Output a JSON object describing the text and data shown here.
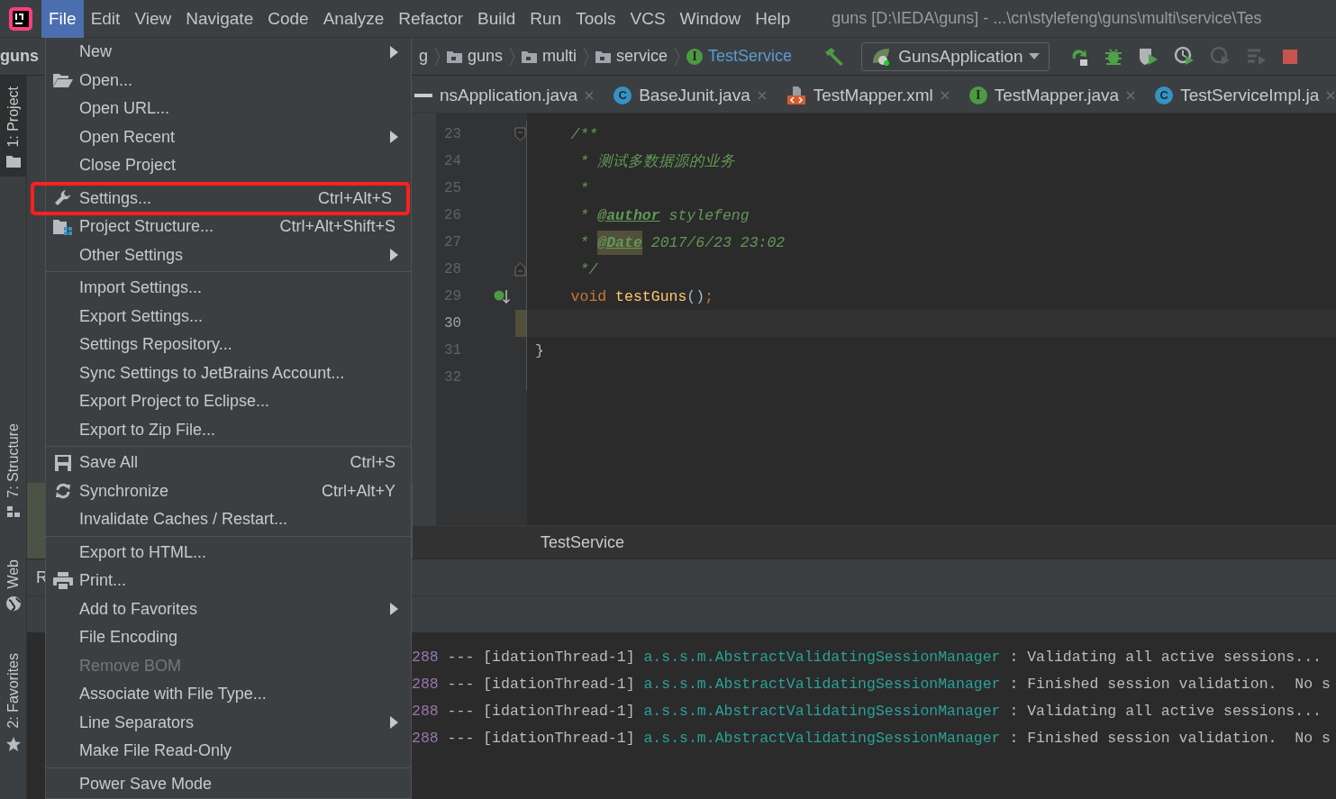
{
  "window": {
    "title": "guns [D:\\IEDA\\guns] - ...\\cn\\stylefeng\\guns\\multi\\service\\Tes"
  },
  "menu_bar": [
    {
      "label": "File",
      "selected": true
    },
    {
      "label": "Edit",
      "selected": false
    },
    {
      "label": "View",
      "selected": false
    },
    {
      "label": "Navigate",
      "selected": false
    },
    {
      "label": "Code",
      "selected": false
    },
    {
      "label": "Analyze",
      "selected": false
    },
    {
      "label": "Refactor",
      "selected": false
    },
    {
      "label": "Build",
      "selected": false
    },
    {
      "label": "Run",
      "selected": false
    },
    {
      "label": "Tools",
      "selected": false
    },
    {
      "label": "VCS",
      "selected": false
    },
    {
      "label": "Window",
      "selected": false
    },
    {
      "label": "Help",
      "selected": false
    }
  ],
  "navigation_bar": {
    "project": "guns",
    "crumbs": [
      {
        "label": "g",
        "kind": "text"
      },
      {
        "label": "guns",
        "kind": "folder"
      },
      {
        "label": "multi",
        "kind": "folder"
      },
      {
        "label": "service",
        "kind": "folder"
      },
      {
        "label": "TestService",
        "kind": "interface",
        "badge": "I"
      }
    ]
  },
  "run_config": {
    "label": "GunsApplication"
  },
  "tool_stripe": [
    {
      "label": "1: Project",
      "selected": true
    },
    {
      "label": "7: Structure",
      "selected": false
    },
    {
      "label": "Web",
      "selected": false
    },
    {
      "label": "2: Favorites",
      "selected": false
    }
  ],
  "editor_tabs": [
    {
      "label": "nsApplication.java",
      "kind": "cut"
    },
    {
      "label": "BaseJunit.java",
      "kind": "class",
      "badge": "C"
    },
    {
      "label": "TestMapper.xml",
      "kind": "xml"
    },
    {
      "label": "TestMapper.java",
      "kind": "interface",
      "badge": "I"
    },
    {
      "label": "TestServiceImpl.ja",
      "kind": "class",
      "badge": "C"
    }
  ],
  "code_lines": [
    {
      "number": "23",
      "current": false,
      "kind": "fold-start",
      "tokens": [
        {
          "text": "    /**",
          "kind": "comment"
        }
      ]
    },
    {
      "number": "24",
      "current": false,
      "tokens": [
        {
          "text": "     * 测试多数据源的业务",
          "kind": "comment"
        }
      ]
    },
    {
      "number": "25",
      "current": false,
      "tokens": [
        {
          "text": "     *",
          "kind": "comment"
        }
      ]
    },
    {
      "number": "26",
      "current": false,
      "tokens": [
        {
          "text": "     * ",
          "kind": "comment"
        },
        {
          "text": "@author",
          "kind": "doctag"
        },
        {
          "text": " stylefeng",
          "kind": "comment"
        }
      ]
    },
    {
      "number": "27",
      "current": false,
      "tokens": [
        {
          "text": "     * ",
          "kind": "comment"
        },
        {
          "text": "@Date",
          "kind": "doctag-marked"
        },
        {
          "text": " 2017/6/23 23:02",
          "kind": "comment"
        }
      ]
    },
    {
      "number": "28",
      "current": false,
      "kind": "fold-end",
      "tokens": [
        {
          "text": "     */",
          "kind": "comment"
        }
      ]
    },
    {
      "number": "29",
      "current": false,
      "kind": "implemented",
      "tokens": [
        {
          "text": "    void",
          "kind": "keyword"
        },
        {
          "text": " testGuns",
          "kind": "method"
        },
        {
          "text": "()",
          "kind": "plain"
        },
        {
          "text": ";",
          "kind": "keyword"
        }
      ]
    },
    {
      "number": "30",
      "current": true
    },
    {
      "number": "31",
      "current": false,
      "tokens": [
        {
          "text": "}",
          "kind": "plain"
        }
      ]
    },
    {
      "number": "32",
      "current": false
    }
  ],
  "breadcrumb": "TestService",
  "run_panel": {
    "title": "R"
  },
  "console": [
    {
      "pid": "288",
      "thread": "--- [idationThread-1]",
      "logger": "a.s.s.m.AbstractValidatingSessionManager",
      "message": ": Validating all active sessions..."
    },
    {
      "pid": "288",
      "thread": "--- [idationThread-1]",
      "logger": "a.s.s.m.AbstractValidatingSessionManager",
      "message": ": Finished session validation.  No s"
    },
    {
      "pid": "288",
      "thread": "--- [idationThread-1]",
      "logger": "a.s.s.m.AbstractValidatingSessionManager",
      "message": ": Validating all active sessions..."
    },
    {
      "pid": "288",
      "thread": "--- [idationThread-1]",
      "logger": "a.s.s.m.AbstractValidatingSessionManager",
      "message": ": Finished session validation.  No s"
    }
  ],
  "file_menu": {
    "groups": [
      {
        "items": [
          {
            "label": "New",
            "submenu": true,
            "disabled": false,
            "outlined": false
          },
          {
            "label": "Open...",
            "submenu": false,
            "disabled": false,
            "outlined": false
          },
          {
            "label": "Open URL...",
            "submenu": false,
            "disabled": false,
            "outlined": false
          },
          {
            "label": "Open Recent",
            "submenu": true,
            "disabled": false,
            "outlined": false
          },
          {
            "label": "Close Project",
            "submenu": false,
            "disabled": false,
            "outlined": false
          }
        ]
      },
      {
        "items": [
          {
            "label": "Settings...",
            "shortcut": "Ctrl+Alt+S",
            "submenu": false,
            "disabled": false,
            "outlined": true
          },
          {
            "label": "Project Structure...",
            "shortcut": "Ctrl+Alt+Shift+S",
            "submenu": false,
            "disabled": false,
            "outlined": false
          },
          {
            "label": "Other Settings",
            "submenu": true,
            "disabled": false,
            "outlined": false
          }
        ]
      },
      {
        "items": [
          {
            "label": "Import Settings...",
            "submenu": false,
            "disabled": false,
            "outlined": false
          },
          {
            "label": "Export Settings...",
            "submenu": false,
            "disabled": false,
            "outlined": false
          },
          {
            "label": "Settings Repository...",
            "submenu": false,
            "disabled": false,
            "outlined": false
          },
          {
            "label": "Sync Settings to JetBrains Account...",
            "submenu": false,
            "disabled": false,
            "outlined": false
          },
          {
            "label": "Export Project to Eclipse...",
            "submenu": false,
            "disabled": false,
            "outlined": false
          },
          {
            "label": "Export to Zip File...",
            "submenu": false,
            "disabled": false,
            "outlined": false
          }
        ]
      },
      {
        "items": [
          {
            "label": "Save All",
            "shortcut": "Ctrl+S",
            "submenu": false,
            "disabled": false,
            "outlined": false
          },
          {
            "label": "Synchronize",
            "shortcut": "Ctrl+Alt+Y",
            "submenu": false,
            "disabled": false,
            "outlined": false
          },
          {
            "label": "Invalidate Caches / Restart...",
            "submenu": false,
            "disabled": false,
            "outlined": false
          }
        ]
      },
      {
        "items": [
          {
            "label": "Export to HTML...",
            "submenu": false,
            "disabled": false,
            "outlined": false
          },
          {
            "label": "Print...",
            "submenu": false,
            "disabled": false,
            "outlined": false
          },
          {
            "label": "Add to Favorites",
            "submenu": true,
            "disabled": false,
            "outlined": false
          },
          {
            "label": "File Encoding",
            "submenu": false,
            "disabled": false,
            "outlined": false
          },
          {
            "label": "Remove BOM",
            "submenu": false,
            "disabled": true,
            "outlined": false
          },
          {
            "label": "Associate with File Type...",
            "submenu": false,
            "disabled": false,
            "outlined": false
          },
          {
            "label": "Line Separators",
            "submenu": true,
            "disabled": false,
            "outlined": false
          },
          {
            "label": "Make File Read-Only",
            "submenu": false,
            "disabled": false,
            "outlined": false
          }
        ]
      },
      {
        "items": [
          {
            "label": "Power Save Mode",
            "submenu": false,
            "disabled": false,
            "outlined": false
          }
        ]
      }
    ]
  }
}
